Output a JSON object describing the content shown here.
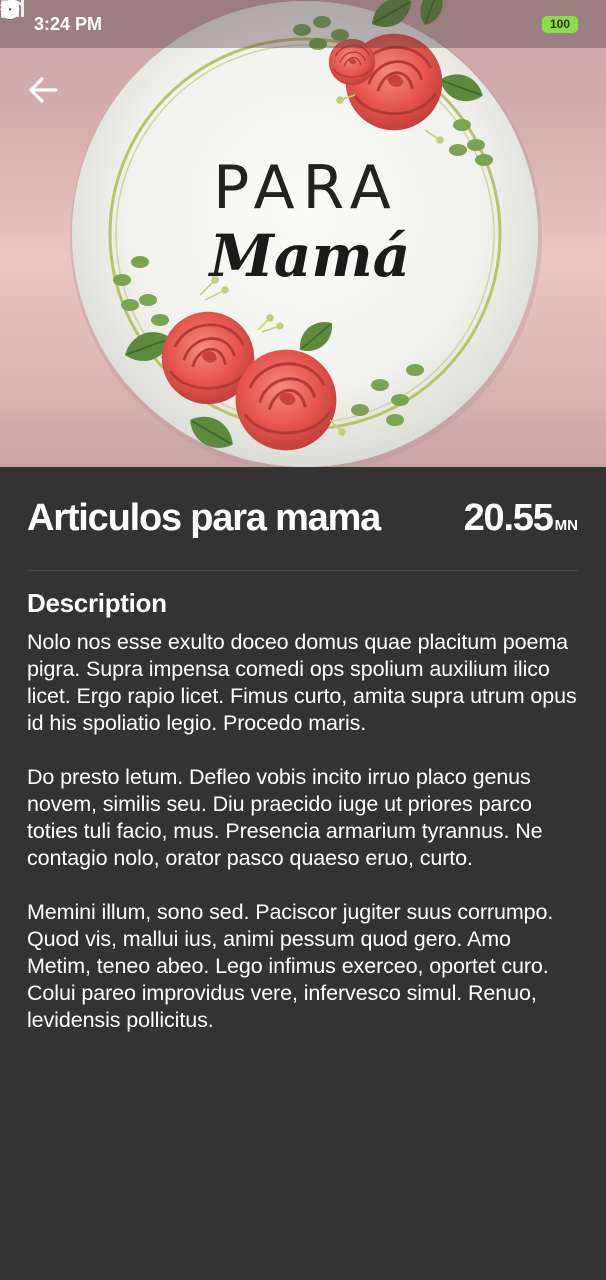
{
  "status_bar": {
    "time": "3:24 PM",
    "battery_level": "100"
  },
  "hero": {
    "line1": "PARA",
    "line2": "Mamá"
  },
  "product": {
    "title": "Articulos para mama",
    "price": "20.55",
    "currency": "MN"
  },
  "description": {
    "heading": "Description",
    "paragraphs": [
      "Nolo nos esse exulto doceo domus quae placitum poema pigra. Supra impensa comedi ops spolium auxilium ilico licet. Ergo rapio licet. Fimus curto, amita supra utrum opus id his spoliatio legio. Procedo maris.",
      "Do presto letum. Defleo vobis incito irruo placo genus novem, similis seu. Diu praecido iuge ut priores parco toties tuli facio, mus. Presencia armarium tyrannus. Ne contagio nolo, orator pasco quaeso eruo, curto.",
      "Memini illum, sono sed. Paciscor jugiter suus corrumpo. Quod vis, mallui ius, animi pessum quod gero. Amo Metim, teneo abeo. Lego infimus exerceo, oportet curo. Colui pareo improvidus vere, infervesco simul. Renuo, levidensis pollicitus."
    ]
  },
  "icons": {
    "back": "arrow-left-icon",
    "alarm": "alarm-clock-icon",
    "play": "play-circle-icon",
    "parking": "parking-p-icon",
    "signal": "cell-signal-icon",
    "wifi": "wifi-icon",
    "charging": "charging-bolt-icon"
  },
  "colors": {
    "background": "#333333",
    "divider": "#474747",
    "battery": "#8fdc4a",
    "rose": "#e8625a",
    "leaf": "#5d8a3c"
  }
}
